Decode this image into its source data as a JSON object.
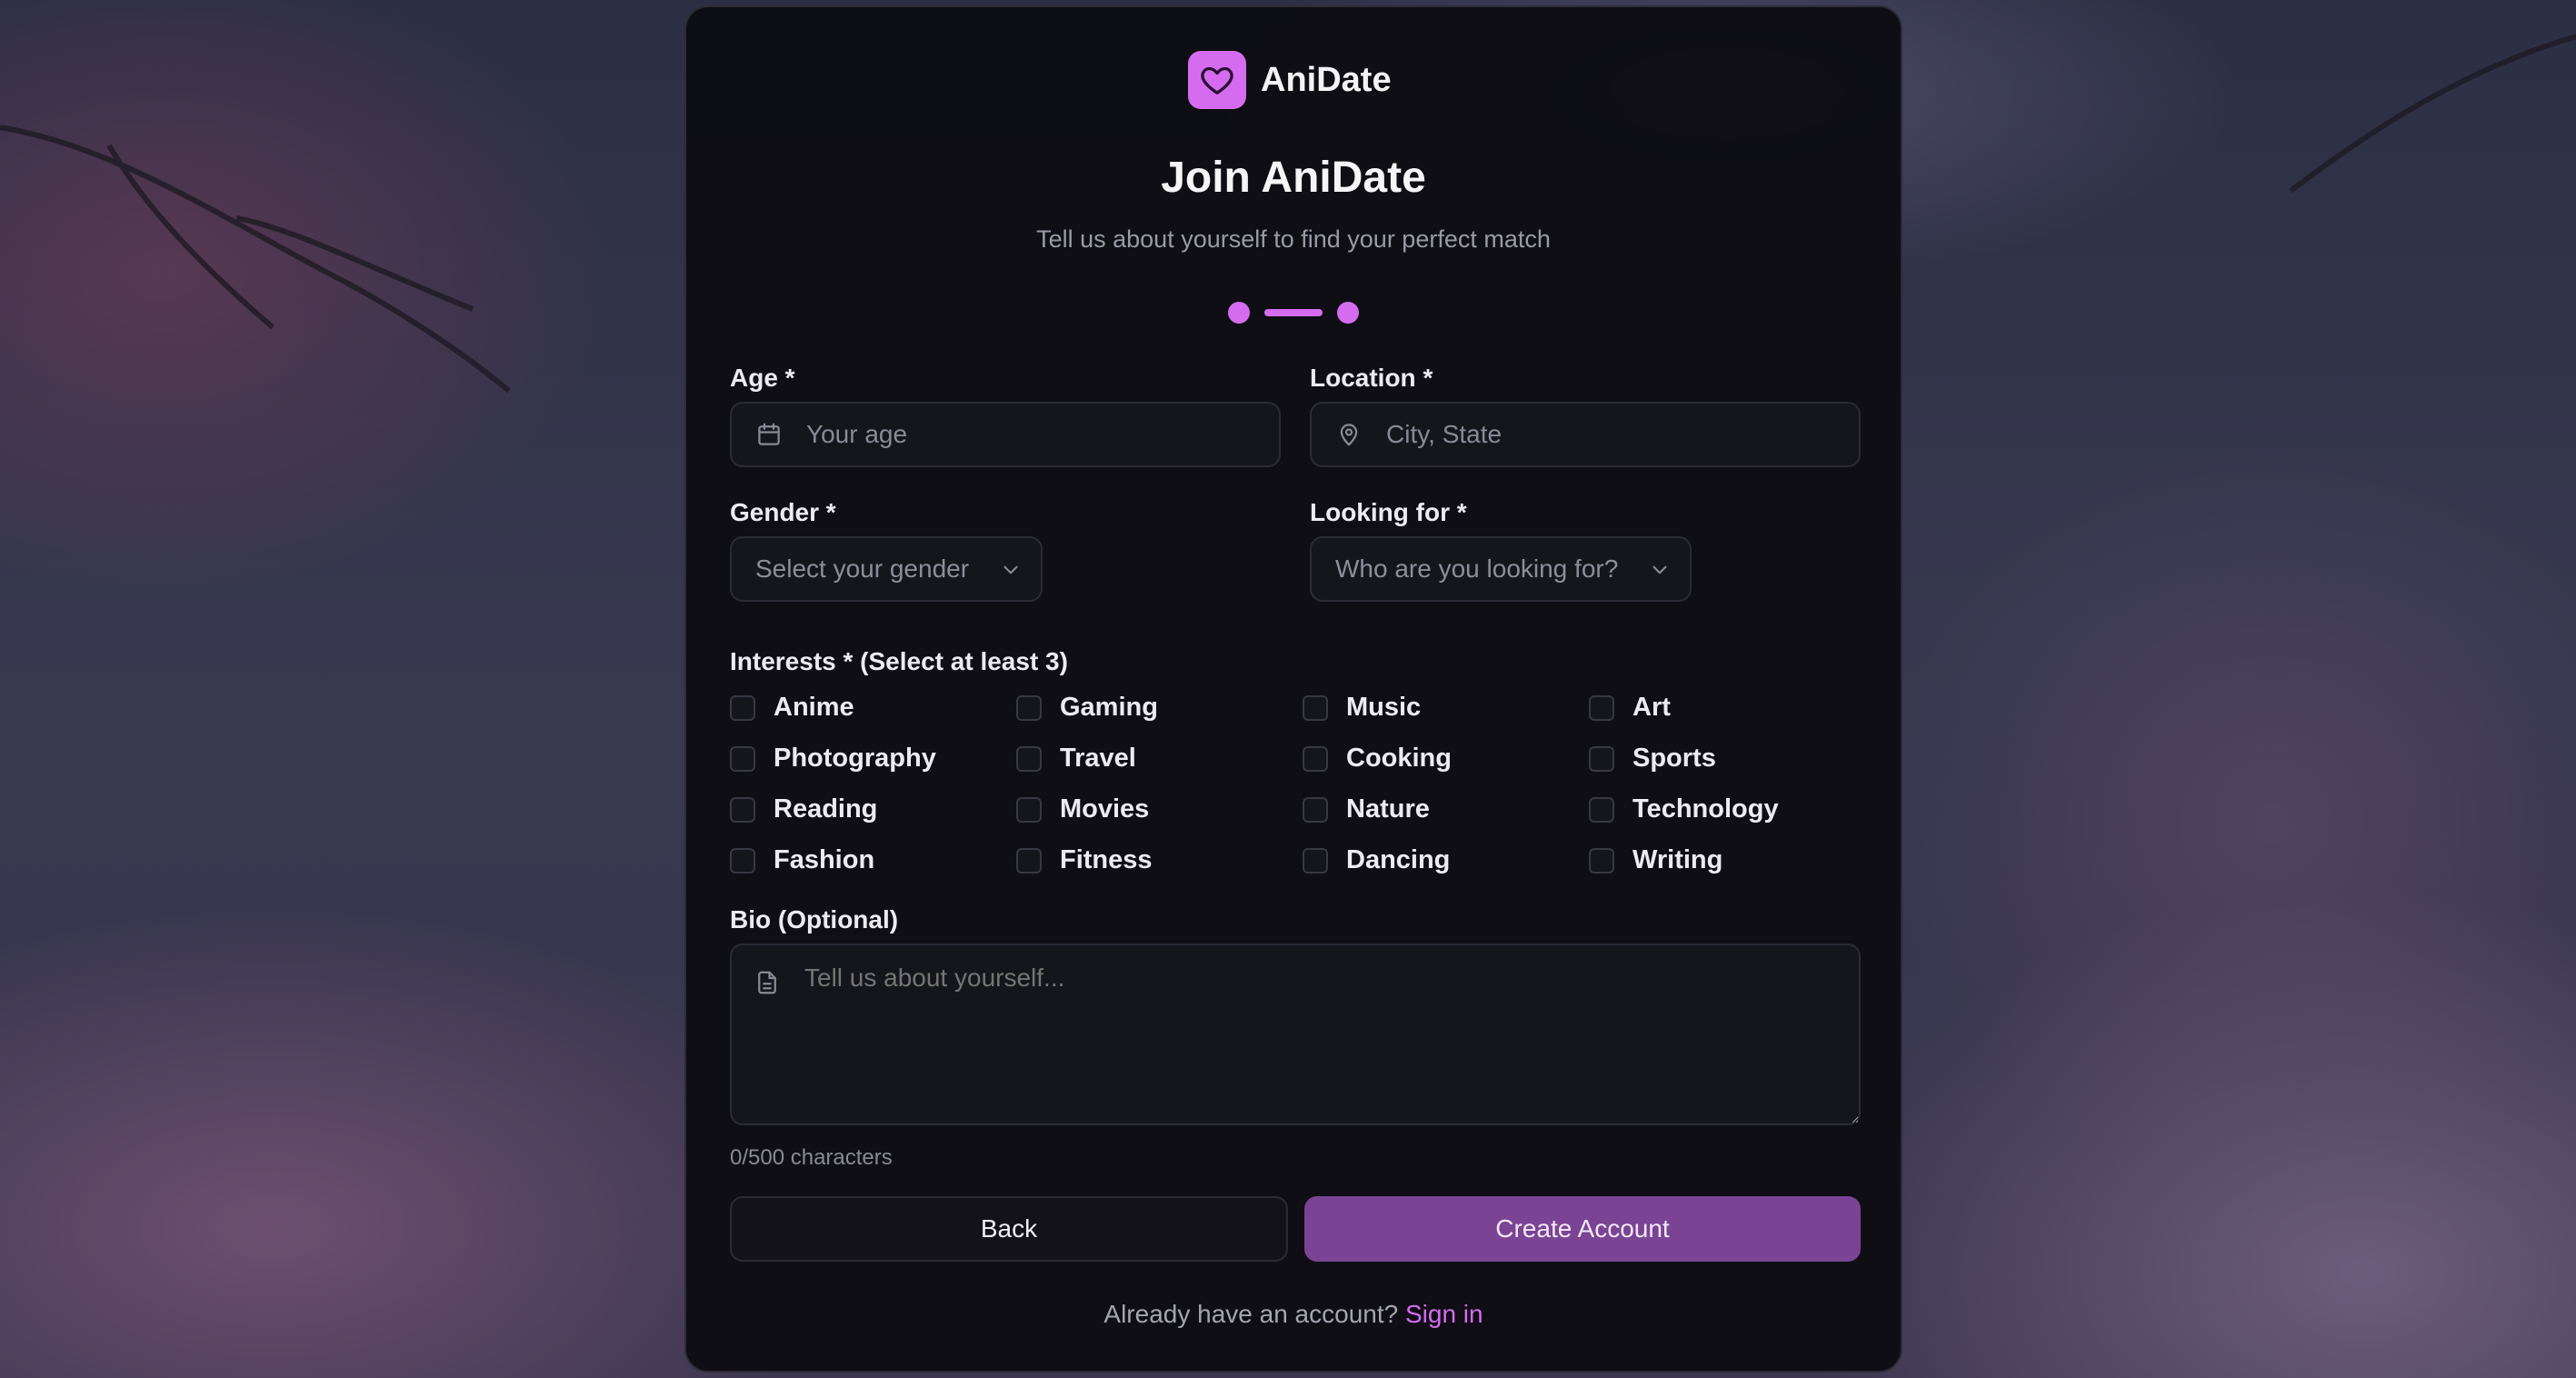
{
  "app": {
    "name": "AniDate",
    "icon": "heart-icon",
    "accent_color": "#d56cf0"
  },
  "header": {
    "title": "Join AniDate",
    "subtitle": "Tell us about yourself to find your perfect match",
    "progress": {
      "steps": 2,
      "current_step": 2
    }
  },
  "form": {
    "age": {
      "label": "Age *",
      "placeholder": "Your age",
      "icon": "calendar-icon"
    },
    "location": {
      "label": "Location *",
      "placeholder": "City, State",
      "icon": "map-pin-icon"
    },
    "gender": {
      "label": "Gender *",
      "placeholder": "Select your gender",
      "icon": "chevron-down-icon"
    },
    "looking_for": {
      "label": "Looking for *",
      "placeholder": "Who are you looking for?",
      "icon": "chevron-down-icon"
    },
    "interests": {
      "label": "Interests * (Select at least 3)",
      "items": [
        "Anime",
        "Gaming",
        "Music",
        "Art",
        "Photography",
        "Travel",
        "Cooking",
        "Sports",
        "Reading",
        "Movies",
        "Nature",
        "Technology",
        "Fashion",
        "Fitness",
        "Dancing",
        "Writing"
      ]
    },
    "bio": {
      "label": "Bio (Optional)",
      "placeholder": "Tell us about yourself...",
      "icon": "document-icon",
      "counter": "0/500 characters"
    }
  },
  "actions": {
    "back_label": "Back",
    "create_label": "Create Account"
  },
  "footer": {
    "prompt": "Already have an account?",
    "link_label": "Sign in"
  }
}
